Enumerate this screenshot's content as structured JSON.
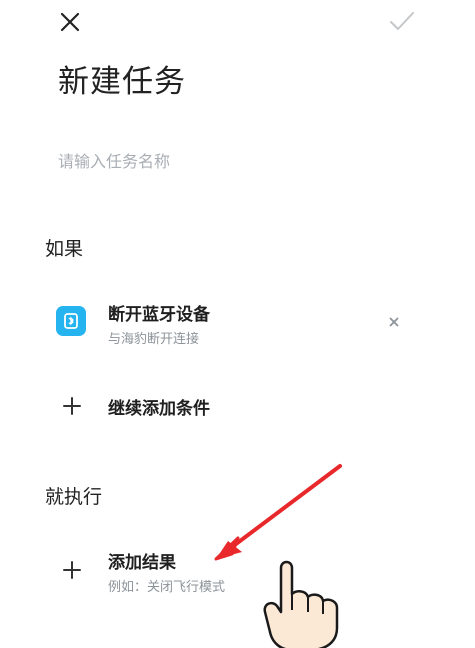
{
  "header": {
    "title": "新建任务",
    "close_icon": "close-icon",
    "confirm_icon": "checkmark-icon"
  },
  "task_name": {
    "value": "",
    "placeholder": "请输入任务名称"
  },
  "if_section": {
    "title": "如果",
    "conditions": [
      {
        "icon": "bluetooth-device-icon",
        "title": "断开蓝牙设备",
        "subtitle": "与海豹断开连接",
        "remove_icon": "remove-icon"
      }
    ],
    "add_condition_label": "继续添加条件"
  },
  "then_section": {
    "title": "就执行",
    "add_result_label": "添加结果",
    "add_result_hint": "例如：关闭飞行模式"
  },
  "colors": {
    "accent_blue": "#26b4f0",
    "annotation_red": "#e8282b",
    "placeholder_gray": "#a9aeb4",
    "subtitle_gray": "#8c9399"
  }
}
